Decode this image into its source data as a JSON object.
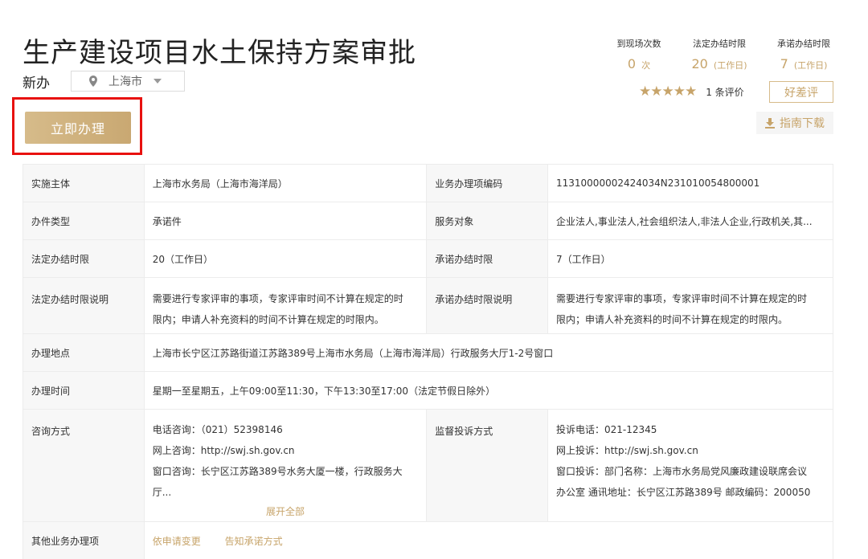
{
  "header": {
    "title": "生产建设项目水土保持方案审批",
    "subtitle": "新办",
    "region": "上海市"
  },
  "apply_label": "立即办理",
  "stats": [
    {
      "label": "到现场次数",
      "value": "0",
      "unit": "次"
    },
    {
      "label": "法定办结时限",
      "value": "20",
      "unit": "(工作日)"
    },
    {
      "label": "承诺办结时限",
      "value": "7",
      "unit": "(工作日)"
    }
  ],
  "rating": {
    "stars": "★★★★★",
    "count": "1 条评价",
    "review_label": "好差评"
  },
  "guide_label": "指南下载",
  "table": {
    "impl_subject": {
      "k": "实施主体",
      "v": "上海市水务局（上海市海洋局）"
    },
    "item_code": {
      "k": "业务办理项编码",
      "v": "11310000002424034N231010054800001"
    },
    "case_type": {
      "k": "办件类型",
      "v": "承诺件"
    },
    "service_target": {
      "k": "服务对象",
      "v": "企业法人,事业法人,社会组织法人,非法人企业,行政机关,其..."
    },
    "legal_limit": {
      "k": "法定办结时限",
      "v": "20（工作日）"
    },
    "promise_limit": {
      "k": "承诺办结时限",
      "v": "7（工作日）"
    },
    "legal_limit_note": {
      "k": "法定办结时限说明",
      "v1": "需要进行专家评审的事项，专家评审时间不计算在规定的时",
      "v2": "限内；申请人补充资料的时间不计算在规定的时限内。"
    },
    "promise_limit_note": {
      "k": "承诺办结时限说明",
      "v1": "需要进行专家评审的事项，专家评审时间不计算在规定的时",
      "v2": "限内；申请人补充资料的时间不计算在规定的时限内。"
    },
    "location": {
      "k": "办理地点",
      "v": "上海市长宁区江苏路街道江苏路389号上海市水务局（上海市海洋局）行政服务大厅1-2号窗口"
    },
    "hours": {
      "k": "办理时间",
      "v": "星期一至星期五，上午09:00至11:30，下午13:30至17:00（法定节假日除外）"
    },
    "consult": {
      "k": "咨询方式",
      "l1": "电话咨询：（021）52398146",
      "l2": "网上咨询：http://swj.sh.gov.cn",
      "l3": "窗口咨询：长宁区江苏路389号水务大厦一楼，行政服务大",
      "l4": "厅...",
      "expand": "展开全部"
    },
    "complaint": {
      "k": "监督投诉方式",
      "l1": "投诉电话：021-12345",
      "l2": "网上投诉：http://swj.sh.gov.cn",
      "l3": "窗口投诉：部门名称：上海市水务局党风廉政建设联席会议",
      "l4": "办公室 通讯地址：长宁区江苏路389号 邮政编码：200050"
    },
    "other": {
      "k": "其他业务办理项",
      "link1": "依申请变更",
      "link2": "告知承诺方式"
    }
  }
}
